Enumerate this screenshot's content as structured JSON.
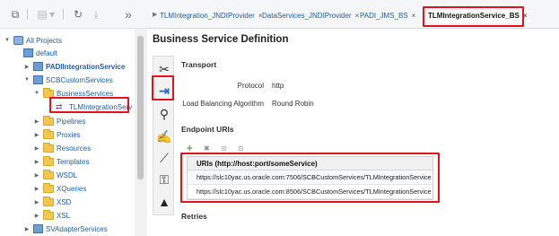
{
  "toolbar": {
    "buttons": [
      {
        "name": "new-project-icon",
        "glyph": "⧉"
      },
      {
        "name": "create-icon",
        "glyph": "▤"
      },
      {
        "name": "dropdown-icon",
        "glyph": "▾"
      },
      {
        "name": "refresh-icon",
        "glyph": "↻"
      },
      {
        "name": "export-icon",
        "glyph": "⤓"
      },
      {
        "name": "collapse-panel-icon",
        "glyph": "»"
      }
    ]
  },
  "tree": {
    "all_projects": "All Projects",
    "default": "default",
    "padi": "PADIIntegrationService",
    "scb": "SCBCustomServices",
    "business_services": "BusinessServices",
    "tlm": "TLMIntegrationServ",
    "pipelines": "Pipelines",
    "proxies": "Proxies",
    "resources": "Resources",
    "templates": "Templates",
    "wsdl": "WSDL",
    "xqueries": "XQueries",
    "xsd": "XSD",
    "xsl": "XSL",
    "svadapter": "SVAdapterServices"
  },
  "tabs": [
    {
      "label": "TLMIntegration_JNDIProvider",
      "close": "×"
    },
    {
      "label": "DataServices_JNDIProvider",
      "close": "×"
    },
    {
      "label": "PADI_JMS_BS",
      "close": "×"
    },
    {
      "label": "TLMIntegrationService_BS",
      "close": "×"
    }
  ],
  "page": {
    "title": "Business Service Definition"
  },
  "side_icons": [
    {
      "name": "tools-icon",
      "glyph": "✂"
    },
    {
      "name": "transport-plug-icon",
      "glyph": "⇥"
    },
    {
      "name": "search-person-icon",
      "glyph": "⚲"
    },
    {
      "name": "handshake-icon",
      "glyph": "✍"
    },
    {
      "name": "chart-icon",
      "glyph": "⟋"
    },
    {
      "name": "security-lock-icon",
      "glyph": "⚿"
    },
    {
      "name": "warning-icon",
      "glyph": "▲"
    }
  ],
  "transport": {
    "section": "Transport",
    "protocol_label": "Protocol",
    "protocol_value": "http",
    "lb_label": "Load Balancing Algorithm",
    "lb_value": "Round Robin"
  },
  "endpoint": {
    "section": "Endpoint URIs",
    "column_header": "URIs (http://host:port/someService)",
    "uris": [
      "https://slc10yac.us.oracle.com:7506/SCBCustomServices/TLMIntegrationService",
      "https://slc10yac.us.oracle.com:8506/SCBCustomServices/TLMIntegrationService"
    ]
  },
  "retries": {
    "section": "Retries"
  },
  "colors": {
    "link": "#1f5fa6",
    "annotation": "#e0141e",
    "folder": "#f3c74e"
  }
}
